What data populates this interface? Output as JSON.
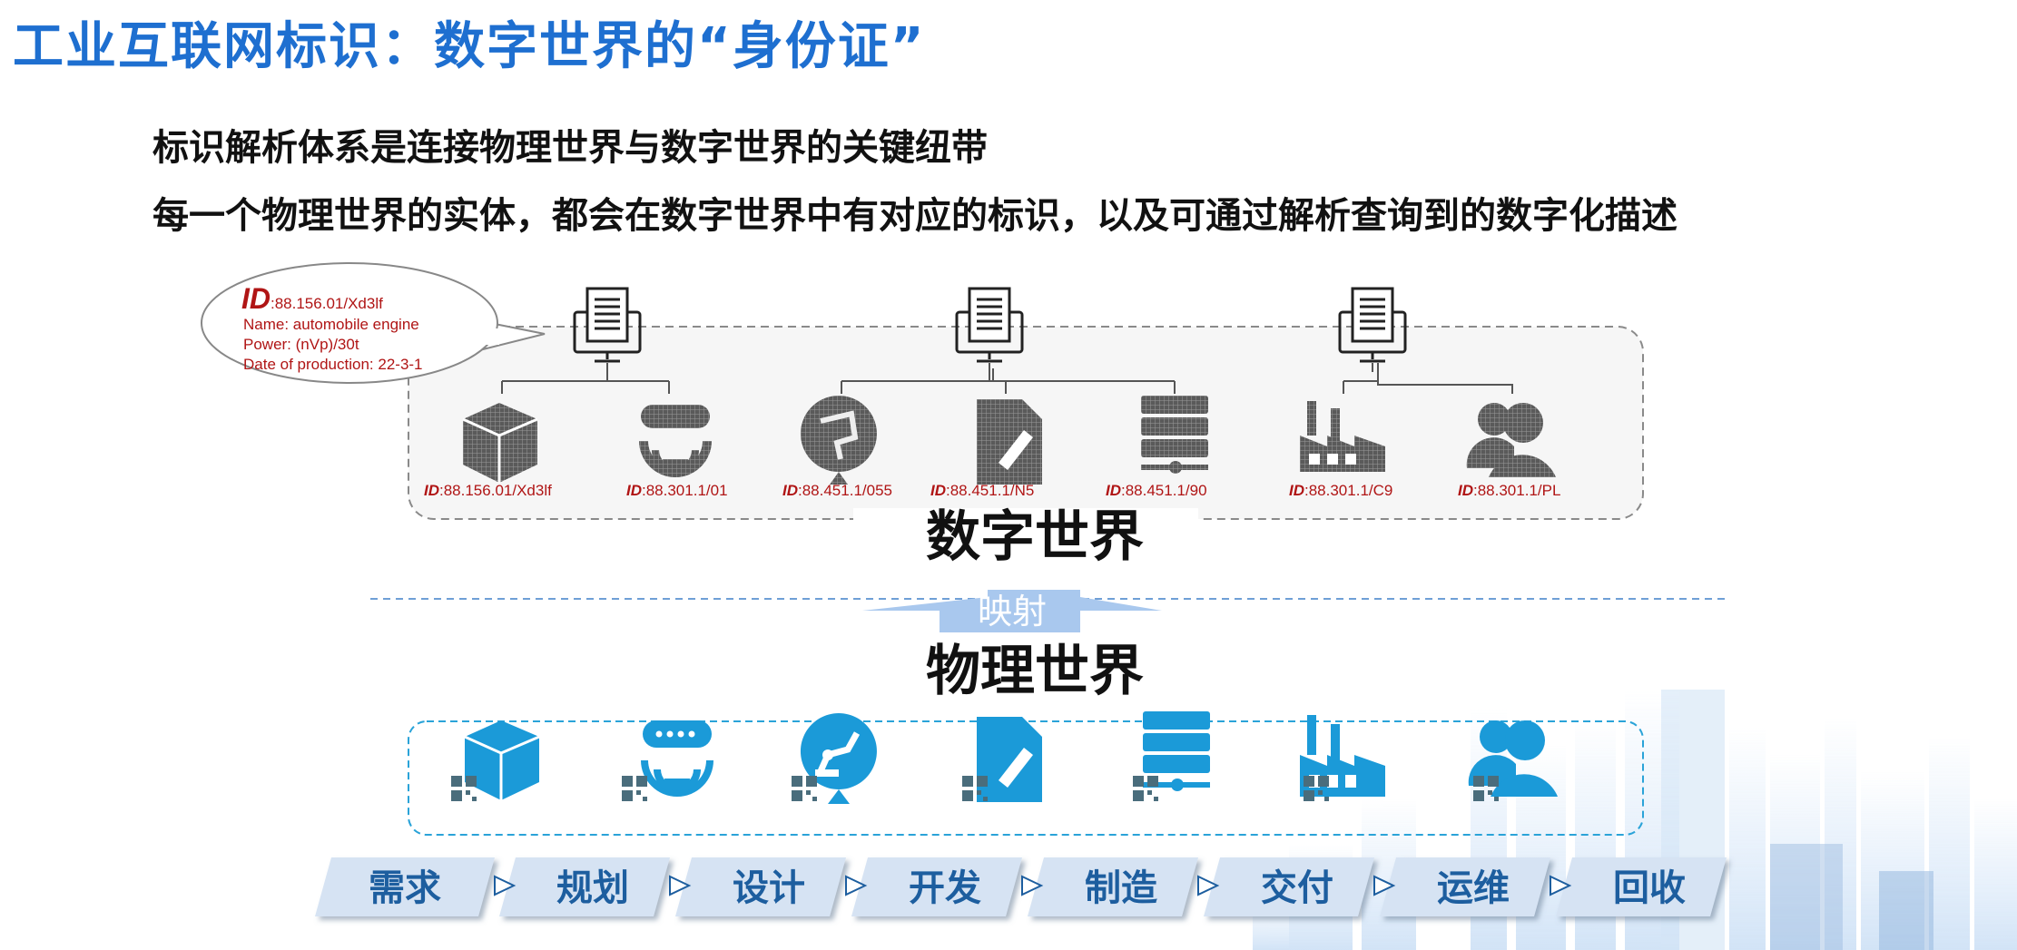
{
  "title": "工业互联网标识：数字世界的“身份证”",
  "subtitle_1": "标识解析体系是连接物理世界与数字世界的关键纽带",
  "subtitle_2": "每一个物理世界的实体，都会在数字世界中有对应的标识，以及可通过解析查询到的数字化描述",
  "callout": {
    "id_prefix": "ID",
    "id_value": ":88.156.01/Xd3lf",
    "lines": [
      "Name: automobile engine",
      "Power: (nVp)/30t",
      "Date of production: 22-3-1"
    ]
  },
  "digital_items": [
    {
      "icon": "box-icon",
      "id_prefix": "ID",
      "id_value": ":88.156.01/Xd3lf"
    },
    {
      "icon": "router-icon",
      "id_prefix": "ID",
      "id_value": ":88.301.1/01"
    },
    {
      "icon": "robot-arm-icon",
      "id_prefix": "ID",
      "id_value": ":88.451.1/055"
    },
    {
      "icon": "document-edit-icon",
      "id_prefix": "ID",
      "id_value": ":88.451.1/N5"
    },
    {
      "icon": "server-icon",
      "id_prefix": "ID",
      "id_value": ":88.451.1/90"
    },
    {
      "icon": "factory-icon",
      "id_prefix": "ID",
      "id_value": ":88.301.1/C9"
    },
    {
      "icon": "users-icon",
      "id_prefix": "ID",
      "id_value": ":88.301.1/PL"
    }
  ],
  "digital_world_label": "数字世界",
  "mapping_label": "映射",
  "physical_world_label": "物理世界",
  "physical_items": [
    "box-icon",
    "router-icon",
    "robot-arm-icon",
    "document-edit-icon",
    "server-icon",
    "factory-icon",
    "users-icon"
  ],
  "lifecycle": [
    "需求",
    "规划",
    "设计",
    "开发",
    "制造",
    "交付",
    "运维",
    "回收"
  ],
  "colors": {
    "title": "#1e6fd0",
    "id_red": "#b01515",
    "physical_icon": "#1b9ad8",
    "digital_icon": "#555555",
    "step_fill": "#d6e3f3",
    "step_text": "#1d5e9f",
    "map_arrow": "#a9c8ee"
  }
}
